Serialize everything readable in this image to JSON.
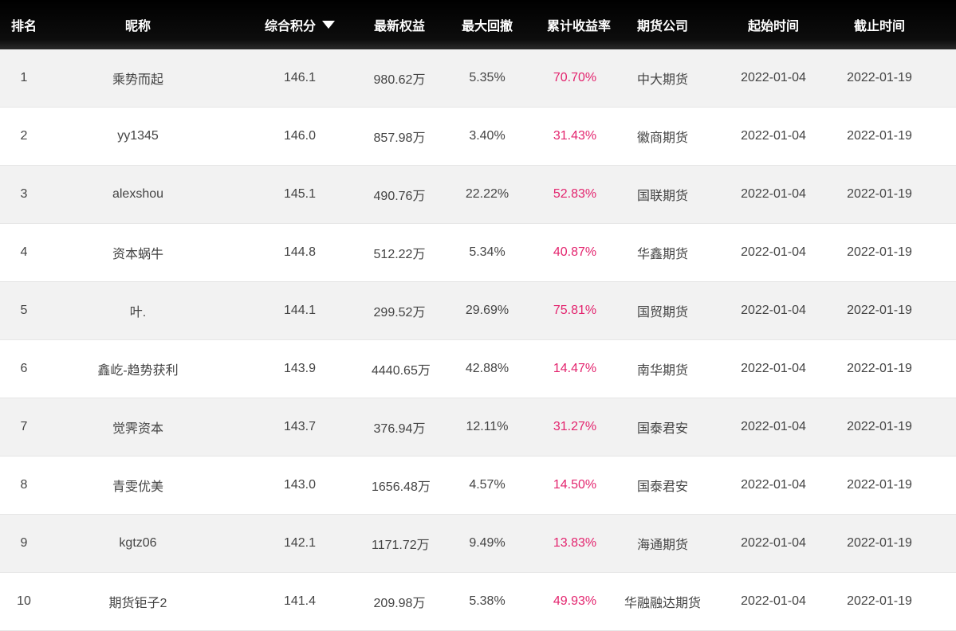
{
  "table": {
    "columns": [
      {
        "key": "rank",
        "label": "排名"
      },
      {
        "key": "nickname",
        "label": "昵称"
      },
      {
        "key": "score",
        "label": "综合积分",
        "sorted": "desc"
      },
      {
        "key": "equity",
        "label": "最新权益"
      },
      {
        "key": "drawdown",
        "label": "最大回撤"
      },
      {
        "key": "return",
        "label": "累计收益率"
      },
      {
        "key": "company",
        "label": "期货公司"
      },
      {
        "key": "start",
        "label": "起始时间"
      },
      {
        "key": "end",
        "label": "截止时间"
      }
    ],
    "rows": [
      {
        "rank": "1",
        "nickname": "乘势而起",
        "score": "146.1",
        "equity": "980.62万",
        "drawdown": "5.35%",
        "return": "70.70%",
        "company": "中大期货",
        "start": "2022-01-04",
        "end": "2022-01-19"
      },
      {
        "rank": "2",
        "nickname": "yy1345",
        "score": "146.0",
        "equity": "857.98万",
        "drawdown": "3.40%",
        "return": "31.43%",
        "company": "徽商期货",
        "start": "2022-01-04",
        "end": "2022-01-19"
      },
      {
        "rank": "3",
        "nickname": "alexshou",
        "score": "145.1",
        "equity": "490.76万",
        "drawdown": "22.22%",
        "return": "52.83%",
        "company": "国联期货",
        "start": "2022-01-04",
        "end": "2022-01-19"
      },
      {
        "rank": "4",
        "nickname": "资本蜗牛",
        "score": "144.8",
        "equity": "512.22万",
        "drawdown": "5.34%",
        "return": "40.87%",
        "company": "华鑫期货",
        "start": "2022-01-04",
        "end": "2022-01-19"
      },
      {
        "rank": "5",
        "nickname": "叶.",
        "score": "144.1",
        "equity": "299.52万",
        "drawdown": "29.69%",
        "return": "75.81%",
        "company": "国贸期货",
        "start": "2022-01-04",
        "end": "2022-01-19"
      },
      {
        "rank": "6",
        "nickname": "鑫屹-趋势获利",
        "score": "143.9",
        "equity": "4440.65万",
        "drawdown": "42.88%",
        "return": "14.47%",
        "company": "南华期货",
        "start": "2022-01-04",
        "end": "2022-01-19"
      },
      {
        "rank": "7",
        "nickname": "觉霁资本",
        "score": "143.7",
        "equity": "376.94万",
        "drawdown": "12.11%",
        "return": "31.27%",
        "company": "国泰君安",
        "start": "2022-01-04",
        "end": "2022-01-19"
      },
      {
        "rank": "8",
        "nickname": "青雯优美",
        "score": "143.0",
        "equity": "1656.48万",
        "drawdown": "4.57%",
        "return": "14.50%",
        "company": "国泰君安",
        "start": "2022-01-04",
        "end": "2022-01-19"
      },
      {
        "rank": "9",
        "nickname": "kgtz06",
        "score": "142.1",
        "equity": "1171.72万",
        "drawdown": "9.49%",
        "return": "13.83%",
        "company": "海通期货",
        "start": "2022-01-04",
        "end": "2022-01-19"
      },
      {
        "rank": "10",
        "nickname": "期货钜子2",
        "score": "141.4",
        "equity": "209.98万",
        "drawdown": "5.38%",
        "return": "49.93%",
        "company": "华融融达期货",
        "start": "2022-01-04",
        "end": "2022-01-19"
      }
    ]
  },
  "colors": {
    "header_bg": "#000000",
    "header_text": "#ffffff",
    "row_alt": "#f2f2f2",
    "return_text": "#e3246e",
    "body_text": "#444444"
  },
  "icons": {
    "sort": "sort-desc-triangle-icon"
  }
}
